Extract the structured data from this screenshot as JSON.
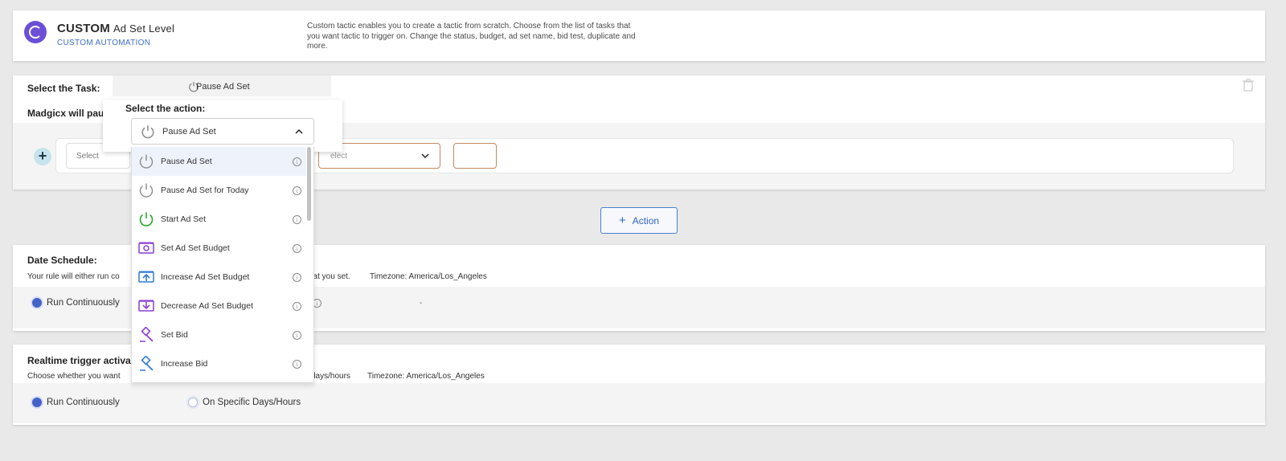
{
  "header": {
    "title": "CUSTOM",
    "level": "Ad Set Level",
    "subtitle": "CUSTOM AUTOMATION",
    "description": "Custom tactic enables you to create a tactic from scratch. Choose from the list of tasks that you want tactic to trigger on. Change the status, budget, ad set name, bid test, duplicate and more."
  },
  "task": {
    "label": "Select the Task:",
    "selected": "Pause Ad Set",
    "madgicx_label": "Madgicx will pau",
    "condition_select_1": "Select",
    "condition_select_2": "elect"
  },
  "action_popup": {
    "label": "Select the action:",
    "selected": "Pause Ad Set",
    "items": [
      {
        "label": "Pause Ad Set",
        "icon": "power-icon-gray"
      },
      {
        "label": "Pause Ad Set for Today",
        "icon": "power-icon-gray"
      },
      {
        "label": "Start Ad Set",
        "icon": "power-icon-green"
      },
      {
        "label": "Set Ad Set Budget",
        "icon": "budget-icon"
      },
      {
        "label": "Increase Ad Set Budget",
        "icon": "budget-increase-icon"
      },
      {
        "label": "Decrease Ad Set Budget",
        "icon": "budget-decrease-icon"
      },
      {
        "label": "Set Bid",
        "icon": "bid-icon"
      },
      {
        "label": "Increase Bid",
        "icon": "bid-increase-icon"
      }
    ]
  },
  "add_action": {
    "label": "Action",
    "plus": "+"
  },
  "date_schedule": {
    "title": "Date Schedule:",
    "desc_start": "Your rule will either run co",
    "desc_end": "hat you set.",
    "timezone": "Timezone: America/Los_Angeles",
    "run_label": "Run Continuously",
    "dash": "-"
  },
  "realtime": {
    "title": "Realtime trigger activa",
    "desc_start": "Choose whether you want",
    "desc_end": "days/hours",
    "timezone": "Timezone: America/Los_Angeles",
    "run_label": "Run Continuously",
    "specific_label": "On Specific Days/Hours"
  },
  "colors": {
    "accent": "#4463c9",
    "logo": "#6b4fd6",
    "link": "#3d6fc7",
    "green": "#2aa52a",
    "purple": "#8a3fd1",
    "blue": "#2f7bd6"
  }
}
